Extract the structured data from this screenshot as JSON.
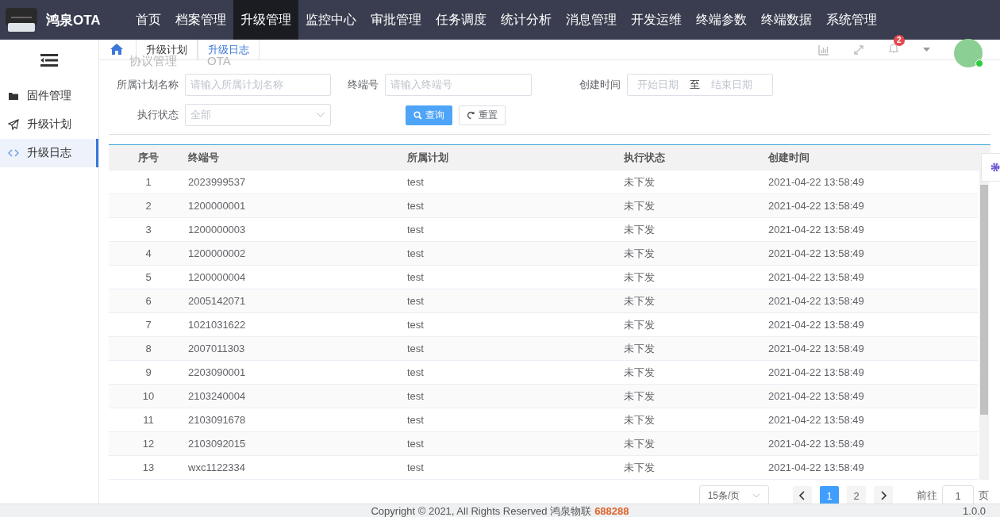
{
  "header": {
    "brand": "鸿泉OTA",
    "nav": [
      {
        "label": "首页",
        "selected": false
      },
      {
        "label": "档案管理",
        "selected": false
      },
      {
        "label": "升级管理",
        "selected": true
      },
      {
        "label": "监控中心",
        "selected": false
      },
      {
        "label": "审批管理",
        "selected": false
      },
      {
        "label": "任务调度",
        "selected": false
      },
      {
        "label": "统计分析",
        "selected": false
      },
      {
        "label": "消息管理",
        "selected": false
      },
      {
        "label": "开发运维",
        "selected": false
      },
      {
        "label": "终端参数",
        "selected": false
      },
      {
        "label": "终端数据",
        "selected": false
      },
      {
        "label": "系统管理",
        "selected": false
      }
    ],
    "notification_count": "2"
  },
  "sidebar": {
    "items": [
      {
        "label": "固件管理",
        "kind": "folder",
        "selected": false
      },
      {
        "label": "升级计划",
        "kind": "send",
        "selected": false
      },
      {
        "label": "升级日志",
        "kind": "code",
        "selected": true
      }
    ]
  },
  "tabs": [
    {
      "label": "升级计划",
      "selected": false
    },
    {
      "label": "升级日志",
      "selected": true
    }
  ],
  "ghost_labels": [
    "协议管理",
    "OTA"
  ],
  "filters": {
    "plan_name": {
      "label": "所属计划名称",
      "placeholder": "请输入所属计划名称"
    },
    "terminal": {
      "label": "终端号",
      "placeholder": "请输入终端号"
    },
    "created": {
      "label": "创建时间",
      "start_placeholder": "开始日期",
      "separator": "至",
      "end_placeholder": "结束日期"
    },
    "status": {
      "label": "执行状态",
      "value": "全部"
    },
    "search_button": "查询",
    "reset_button": "重置"
  },
  "table": {
    "columns": [
      "序号",
      "终端号",
      "所属计划",
      "执行状态",
      "创建时间"
    ],
    "rows": [
      [
        "1",
        "2023999537",
        "test",
        "未下发",
        "2021-04-22 13:58:49"
      ],
      [
        "2",
        "1200000001",
        "test",
        "未下发",
        "2021-04-22 13:58:49"
      ],
      [
        "3",
        "1200000003",
        "test",
        "未下发",
        "2021-04-22 13:58:49"
      ],
      [
        "4",
        "1200000002",
        "test",
        "未下发",
        "2021-04-22 13:58:49"
      ],
      [
        "5",
        "1200000004",
        "test",
        "未下发",
        "2021-04-22 13:58:49"
      ],
      [
        "6",
        "2005142071",
        "test",
        "未下发",
        "2021-04-22 13:58:49"
      ],
      [
        "7",
        "1021031622",
        "test",
        "未下发",
        "2021-04-22 13:58:49"
      ],
      [
        "8",
        "2007011303",
        "test",
        "未下发",
        "2021-04-22 13:58:49"
      ],
      [
        "9",
        "2203090001",
        "test",
        "未下发",
        "2021-04-22 13:58:49"
      ],
      [
        "10",
        "2103240004",
        "test",
        "未下发",
        "2021-04-22 13:58:49"
      ],
      [
        "11",
        "2103091678",
        "test",
        "未下发",
        "2021-04-22 13:58:49"
      ],
      [
        "12",
        "2103092015",
        "test",
        "未下发",
        "2021-04-22 13:58:49"
      ],
      [
        "13",
        "wxc1122334",
        "test",
        "未下发",
        "2021-04-22 13:58:49"
      ]
    ]
  },
  "pagination": {
    "page_size": "15条/页",
    "pages": [
      {
        "label": "1",
        "selected": true
      },
      {
        "label": "2",
        "selected": false
      }
    ],
    "goto_label": "前往",
    "goto_value": "1",
    "goto_suffix": "页"
  },
  "footer": {
    "copyright": "Copyright © 2021, All Rights Reserved 鸿泉物联",
    "code": "688288",
    "version": "1.0.0"
  }
}
